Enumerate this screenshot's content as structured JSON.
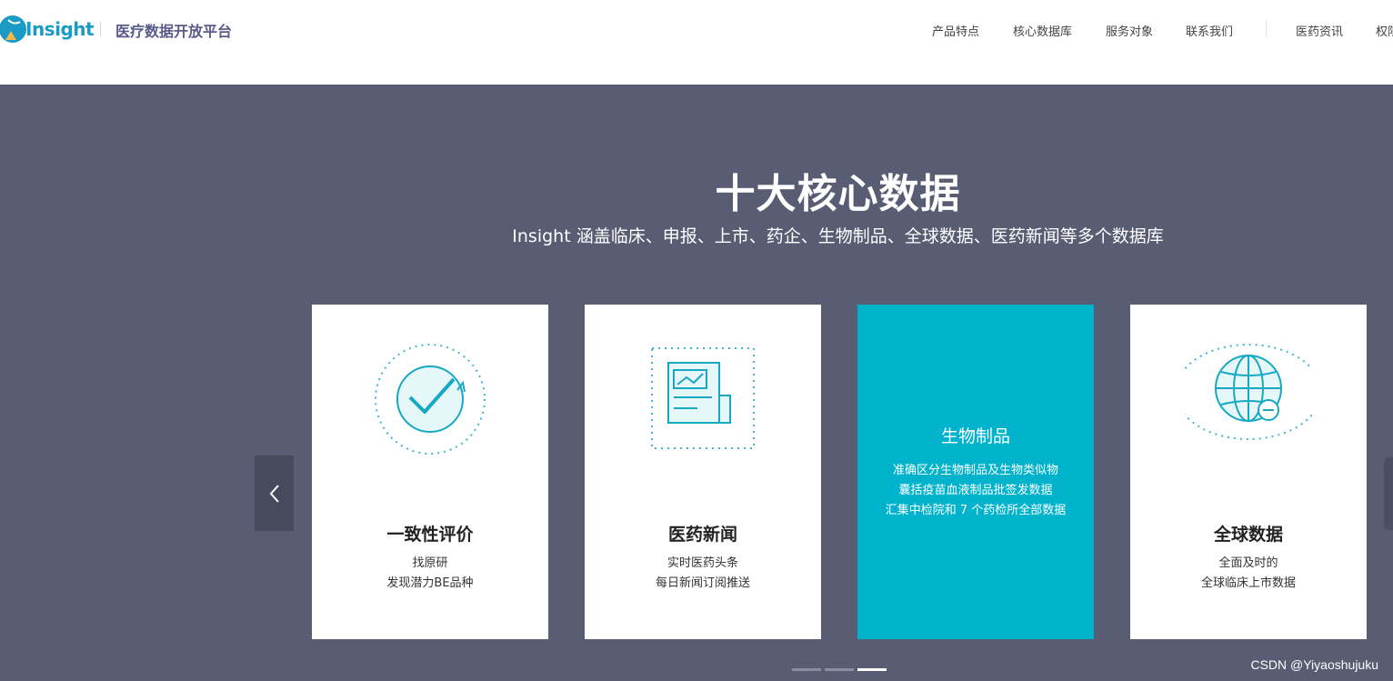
{
  "header": {
    "brand": "Insight",
    "platform_title": "医疗数据开放平台",
    "nav": [
      "产品特点",
      "核心数据库",
      "服务对象",
      "联系我们",
      "医药资讯",
      "权限"
    ]
  },
  "section": {
    "title": "十大核心数据",
    "subtitle": "Insight 涵盖临床、申报、上市、药企、生物制品、全球数据、医药新闻等多个数据库"
  },
  "cards": [
    {
      "title": "一致性评价",
      "desc": [
        "找原研",
        "发现潜力BE品种"
      ],
      "icon": "check-circle-icon"
    },
    {
      "title": "医药新闻",
      "desc": [
        "实时医药头条",
        "每日新闻订阅推送"
      ],
      "icon": "newspaper-icon"
    },
    {
      "title": "生物制品",
      "desc": [
        "准确区分生物制品及生物类似物",
        "囊括疫苗血液制品批签发数据",
        "汇集中检院和 7 个药检所全部数据"
      ],
      "icon": ""
    },
    {
      "title": "全球数据",
      "desc": [
        "全面及时的",
        "全球临床上市数据"
      ],
      "icon": "globe-icon"
    }
  ],
  "carousel": {
    "page_count": 3,
    "active_page": 3
  },
  "colors": {
    "accent": "#00b3cc",
    "background": "#585d73",
    "brand": "#1a9bc6"
  },
  "watermark": "CSDN @Yiyaoshujuku"
}
